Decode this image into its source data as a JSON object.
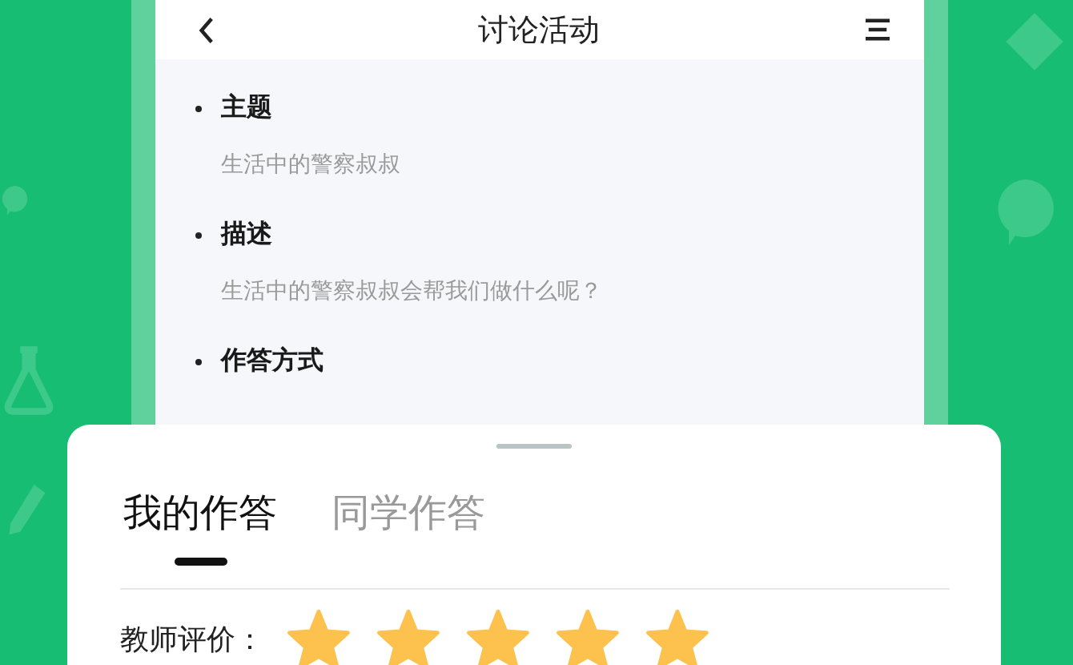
{
  "header": {
    "title": "讨论活动"
  },
  "sections": [
    {
      "heading": "主题",
      "text": "生活中的警察叔叔"
    },
    {
      "heading": "描述",
      "text": "生活中的警察叔叔会帮我们做什么呢？"
    },
    {
      "heading": "作答方式"
    }
  ],
  "answer_sheet": {
    "tabs": [
      {
        "label": "我的作答",
        "selected": true
      },
      {
        "label": "同学作答",
        "selected": false
      }
    ],
    "rating": {
      "label": "教师评价：",
      "stars": 5
    }
  }
}
